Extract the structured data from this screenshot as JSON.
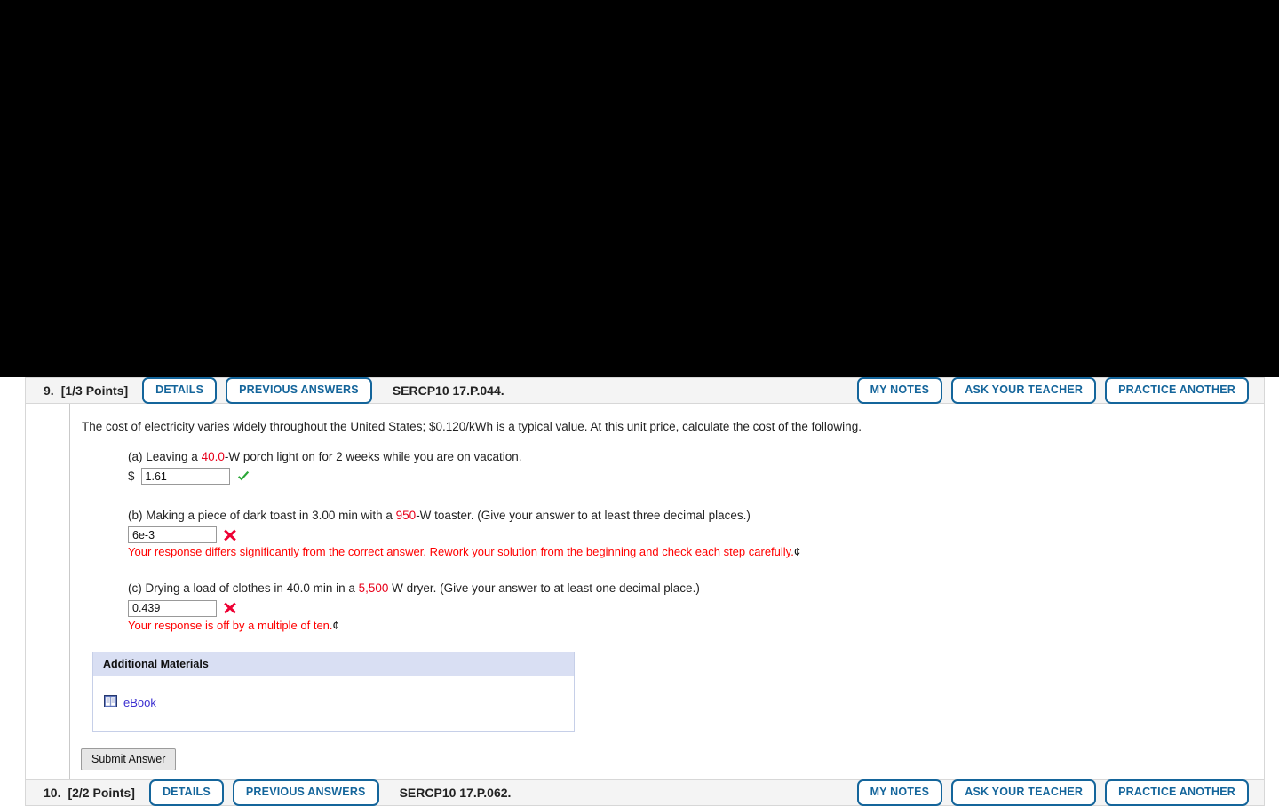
{
  "questions": [
    {
      "number": "9.",
      "points": "[1/3 Points]",
      "details_label": "DETAILS",
      "previous_answers_label": "PREVIOUS ANSWERS",
      "code": "SERCP10 17.P.044.",
      "my_notes_label": "MY NOTES",
      "ask_teacher_label": "ASK YOUR TEACHER",
      "practice_another_label": "PRACTICE ANOTHER",
      "stem_before": "The cost of electricity varies widely throughout the United States; $0.120/kWh is a typical value. At this unit price, calculate the cost of the following.",
      "parts": [
        {
          "prefix": "(a) Leaving a ",
          "highlight": "40.0",
          "suffix": "-W porch light on for 2 weeks while you are on vacation.",
          "currency_prefix": "$",
          "value": "1.61",
          "status": "correct",
          "status_icon": "green-check-icon",
          "feedback": "",
          "feedback_suffix": ""
        },
        {
          "prefix": "(b) Making a piece of dark toast in 3.00 min with a ",
          "highlight": "950",
          "suffix": "-W toaster. (Give your answer to at least three decimal places.)",
          "currency_prefix": "",
          "value": "6e-3",
          "status": "incorrect",
          "status_icon": "red-x-icon",
          "feedback": "Your response differs significantly from the correct answer. Rework your solution from the beginning and check each step carefully.",
          "feedback_suffix": "¢"
        },
        {
          "prefix": "(c) Drying a load of clothes in 40.0 min in a ",
          "highlight": "5,500",
          "suffix": " W dryer. (Give your answer to at least one decimal place.)",
          "currency_prefix": "",
          "value": "0.439",
          "status": "incorrect",
          "status_icon": "red-x-icon",
          "feedback": "Your response is off by a multiple of ten.",
          "feedback_suffix": "¢"
        }
      ],
      "additional_materials": {
        "title": "Additional Materials",
        "items": [
          {
            "label": "eBook",
            "icon": "ebook-icon"
          }
        ]
      },
      "submit_label": "Submit Answer"
    },
    {
      "number": "10.",
      "points": "[2/2 Points]",
      "details_label": "DETAILS",
      "previous_answers_label": "PREVIOUS ANSWERS",
      "code": "SERCP10 17.P.062.",
      "my_notes_label": "MY NOTES",
      "ask_teacher_label": "ASK YOUR TEACHER",
      "practice_another_label": "PRACTICE ANOTHER"
    }
  ],
  "colors": {
    "accent_blue": "#14659b",
    "highlight_red": "#e8001a",
    "feedback_red": "#ff0000",
    "correct_green": "#2aa737",
    "incorrect_red": "#ee0033",
    "link_purple": "#3b2fd0",
    "header_bg": "#f4f4f4",
    "addmat_header_bg": "#d9dff3"
  }
}
